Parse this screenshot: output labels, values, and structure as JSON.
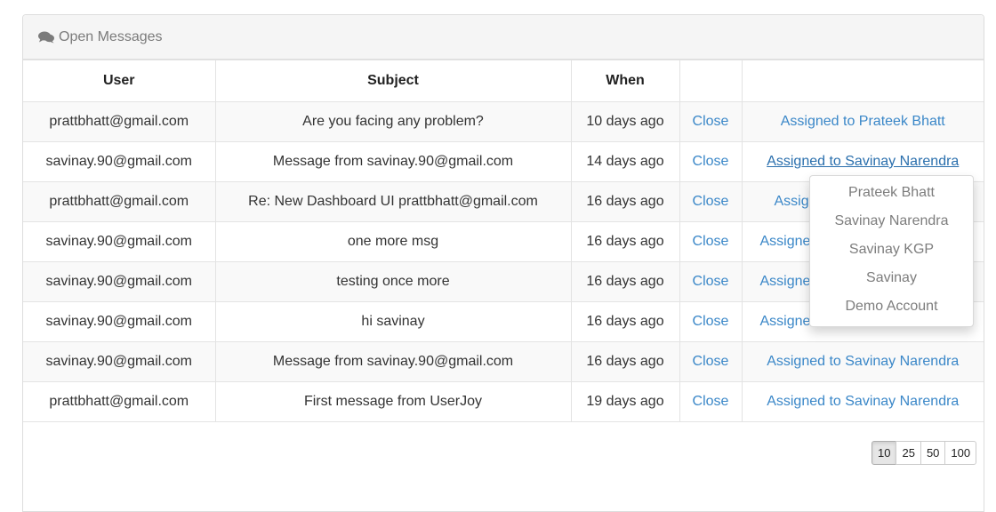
{
  "panel": {
    "title": "Open Messages",
    "icon": "comments-icon"
  },
  "table": {
    "headers": [
      "User",
      "Subject",
      "When",
      "",
      ""
    ],
    "rows": [
      {
        "user": "prattbhatt@gmail.com",
        "subject": "Are you facing any problem?",
        "when": "10 days ago",
        "close": "Close",
        "assigned": "Assigned to Prateek Bhatt"
      },
      {
        "user": "savinay.90@gmail.com",
        "subject": "Message from savinay.90@gmail.com",
        "when": "14 days ago",
        "close": "Close",
        "assigned": "Assigned to Savinay Narendra"
      },
      {
        "user": "prattbhatt@gmail.com",
        "subject": "Re: New Dashboard UI prattbhatt@gmail.com",
        "when": "16 days ago",
        "close": "Close",
        "assigned": "Assig"
      },
      {
        "user": "savinay.90@gmail.com",
        "subject": "one more msg",
        "when": "16 days ago",
        "close": "Close",
        "assigned": "Assigne"
      },
      {
        "user": "savinay.90@gmail.com",
        "subject": "testing once more",
        "when": "16 days ago",
        "close": "Close",
        "assigned": "Assigne"
      },
      {
        "user": "savinay.90@gmail.com",
        "subject": "hi savinay",
        "when": "16 days ago",
        "close": "Close",
        "assigned": "Assigne"
      },
      {
        "user": "savinay.90@gmail.com",
        "subject": "Message from savinay.90@gmail.com",
        "when": "16 days ago",
        "close": "Close",
        "assigned": "Assigned to Savinay Narendra"
      },
      {
        "user": "prattbhatt@gmail.com",
        "subject": "First message from UserJoy",
        "when": "19 days ago",
        "close": "Close",
        "assigned": "Assigned to Savinay Narendra"
      }
    ]
  },
  "assign_dropdown": {
    "options": [
      "Prateek Bhatt",
      "Savinay Narendra",
      "Savinay KGP",
      "Savinay",
      "Demo Account"
    ]
  },
  "pagination": {
    "sizes": [
      "10",
      "25",
      "50",
      "100"
    ],
    "active": "10"
  },
  "colors": {
    "link": "#3a87c8",
    "heading_bg": "#f5f5f5",
    "stripe": "#f9f9f9"
  }
}
